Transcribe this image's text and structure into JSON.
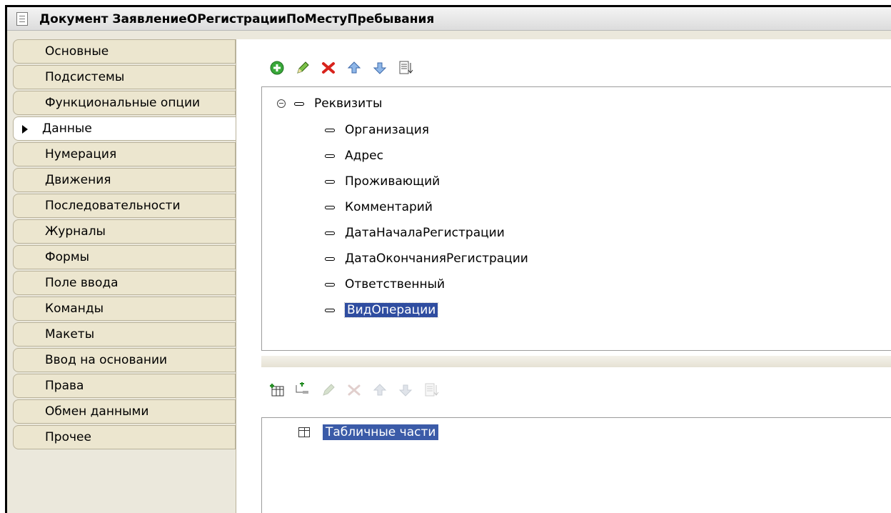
{
  "window": {
    "title": "Документ ЗаявлениеОРегистрацииПоМестуПребывания"
  },
  "tabs": [
    {
      "label": "Основные",
      "active": false
    },
    {
      "label": "Подсистемы",
      "active": false
    },
    {
      "label": "Функциональные опции",
      "active": false
    },
    {
      "label": "Данные",
      "active": true
    },
    {
      "label": "Нумерация",
      "active": false
    },
    {
      "label": "Движения",
      "active": false
    },
    {
      "label": "Последовательности",
      "active": false
    },
    {
      "label": "Журналы",
      "active": false
    },
    {
      "label": "Формы",
      "active": false
    },
    {
      "label": "Поле ввода",
      "active": false
    },
    {
      "label": "Команды",
      "active": false
    },
    {
      "label": "Макеты",
      "active": false
    },
    {
      "label": "Ввод на основании",
      "active": false
    },
    {
      "label": "Права",
      "active": false
    },
    {
      "label": "Обмен данными",
      "active": false
    },
    {
      "label": "Прочее",
      "active": false
    }
  ],
  "attributes_toolbar": {
    "icons": [
      "add-icon",
      "edit-icon",
      "delete-icon",
      "move-up-icon",
      "move-down-icon",
      "sort-icon"
    ]
  },
  "attributes_tree": {
    "root": "Реквизиты",
    "items": [
      "Организация",
      "Адрес",
      "Проживающий",
      "Комментарий",
      "ДатаНачалаРегистрации",
      "ДатаОкончанияРегистрации",
      "Ответственный",
      "ВидОперации"
    ],
    "selected_index": 7
  },
  "tabular_toolbar": {
    "icons": [
      "add-table-icon",
      "add-column-icon",
      "edit-icon",
      "delete-icon",
      "move-up-icon",
      "move-down-icon",
      "sort-icon"
    ]
  },
  "tabular_tree": {
    "root": "Табличные части"
  },
  "colors": {
    "selection": "#2f4da0",
    "tab_bg": "#ece6cf",
    "panel_bg": "#ebe8dc"
  }
}
